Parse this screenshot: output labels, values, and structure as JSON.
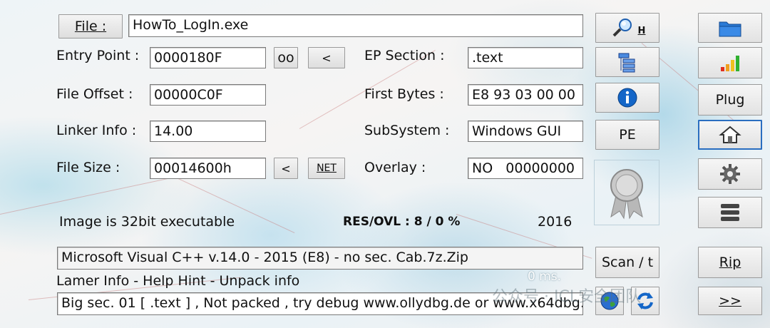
{
  "file": {
    "button_label": "File :",
    "path": "HowTo_LogIn.exe"
  },
  "info": {
    "entry_point_label": "Entry Point :",
    "entry_point_value": "0000180F",
    "oo_button": "oo",
    "ep_less_button": "<",
    "ep_section_label": "EP Section :",
    "ep_section_value": ".text",
    "file_offset_label": "File Offset :",
    "file_offset_value": "00000C0F",
    "first_bytes_label": "First Bytes :",
    "first_bytes_value": "E8 93 03 00 00",
    "linker_info_label": "Linker Info :",
    "linker_info_value": "14.00",
    "subsystem_label": "SubSystem :",
    "subsystem_value": "Windows GUI",
    "file_size_label": "File Size :",
    "file_size_value": "00014600h",
    "size_less_button": "<",
    "net_button": "NET",
    "overlay_label": "Overlay :",
    "overlay_value": "NO   00000000"
  },
  "status": {
    "image_type": "Image is 32bit executable",
    "res_ovl": "RES/OVL : 8 / 0 %",
    "year": "2016",
    "detection": "Microsoft Visual C++ v.14.0 - 2015 (E8) - no sec. Cab.7z.Zip",
    "lamer_info": "Lamer Info - Help Hint - Unpack info",
    "timing": "0 ms.",
    "hint": "Big sec. 01 [ .text ] , Not packed , try debug www.ollydbg.de or www.x64dbg.com"
  },
  "buttons": {
    "search_hotkey": "H",
    "pe": "PE",
    "scan": "Scan / t",
    "plug": "Plug",
    "rip": "Rip",
    "next": ">>"
  },
  "watermark": "公众号 · ICL安全团队",
  "colors": {
    "info_blue": "#1466c8",
    "folder_blue": "#2a7ad6",
    "bar_red": "#e03020",
    "bar_orange": "#f0a020",
    "bar_green": "#30b030"
  }
}
